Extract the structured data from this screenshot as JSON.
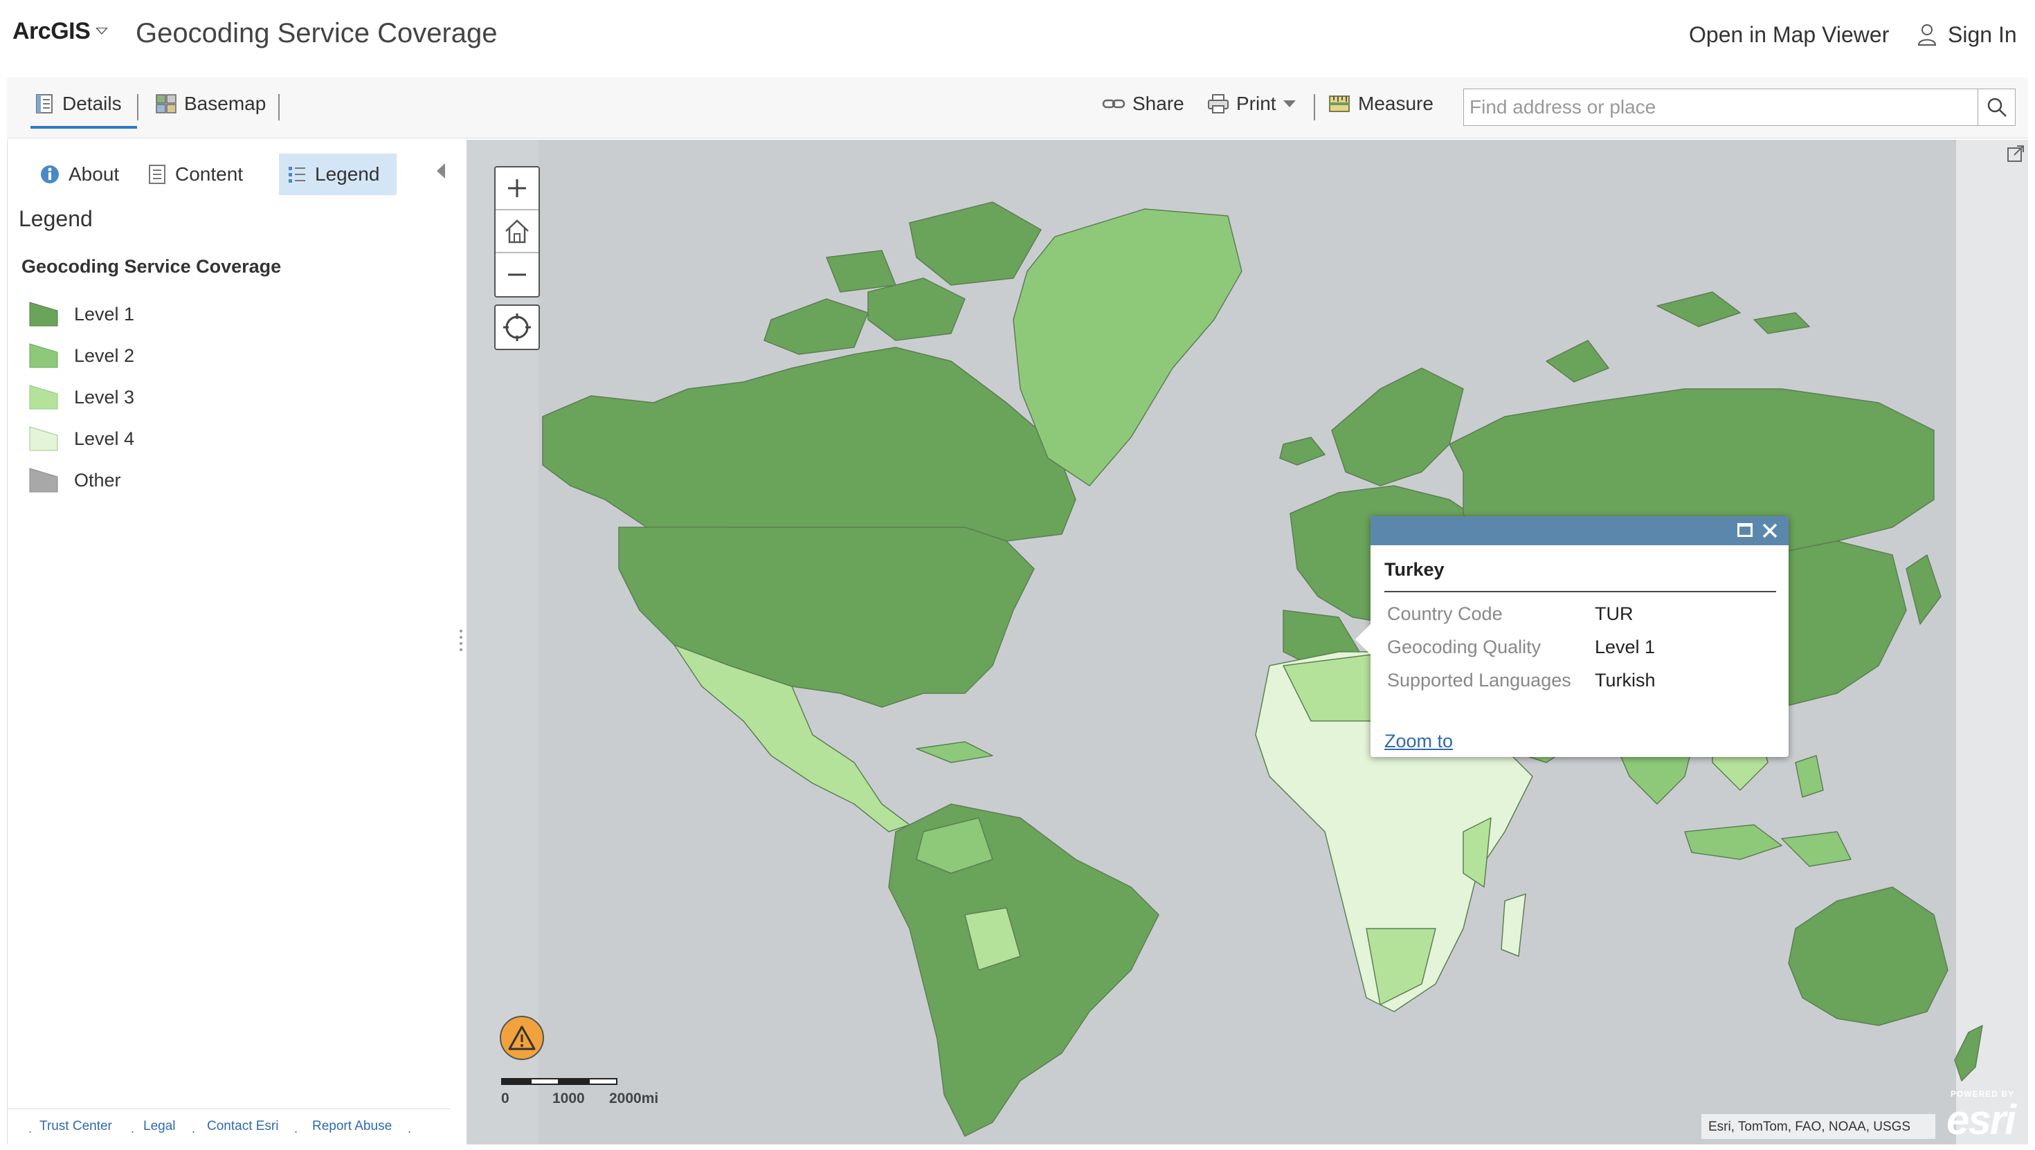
{
  "header": {
    "brand": "ArcGIS",
    "title": "Geocoding Service Coverage",
    "open_map_viewer": "Open in Map Viewer",
    "sign_in": "Sign In"
  },
  "toolbar": {
    "details": "Details",
    "basemap": "Basemap",
    "share": "Share",
    "print": "Print",
    "measure": "Measure",
    "search_placeholder": "Find address or place"
  },
  "panel": {
    "tabs": [
      "About",
      "Content",
      "Legend"
    ],
    "active_tab": "Legend",
    "heading": "Legend",
    "layer_title": "Geocoding Service Coverage",
    "legend_items": [
      {
        "label": "Level 1",
        "color": "#6aa35a"
      },
      {
        "label": "Level 2",
        "color": "#8ec97a"
      },
      {
        "label": "Level 3",
        "color": "#b5e29b"
      },
      {
        "label": "Level 4",
        "color": "#e3f4d8"
      },
      {
        "label": "Other",
        "color": "#a8a8a8"
      }
    ],
    "footer_links": [
      "Trust Center",
      "Legal",
      "Contact Esri",
      "Report Abuse"
    ]
  },
  "map": {
    "scale_labels": [
      "0",
      "1000",
      "2000mi"
    ],
    "attribution": "Esri, TomTom, FAO, NOAA, USGS",
    "logo_top": "POWERED BY",
    "logo_word": "esri"
  },
  "popup": {
    "title": "Turkey",
    "rows": [
      {
        "key": "Country Code",
        "value": "TUR"
      },
      {
        "key": "Geocoding Quality",
        "value": "Level 1"
      },
      {
        "key": "Supported Languages",
        "value": "Turkish"
      }
    ],
    "zoom_to": "Zoom to"
  }
}
